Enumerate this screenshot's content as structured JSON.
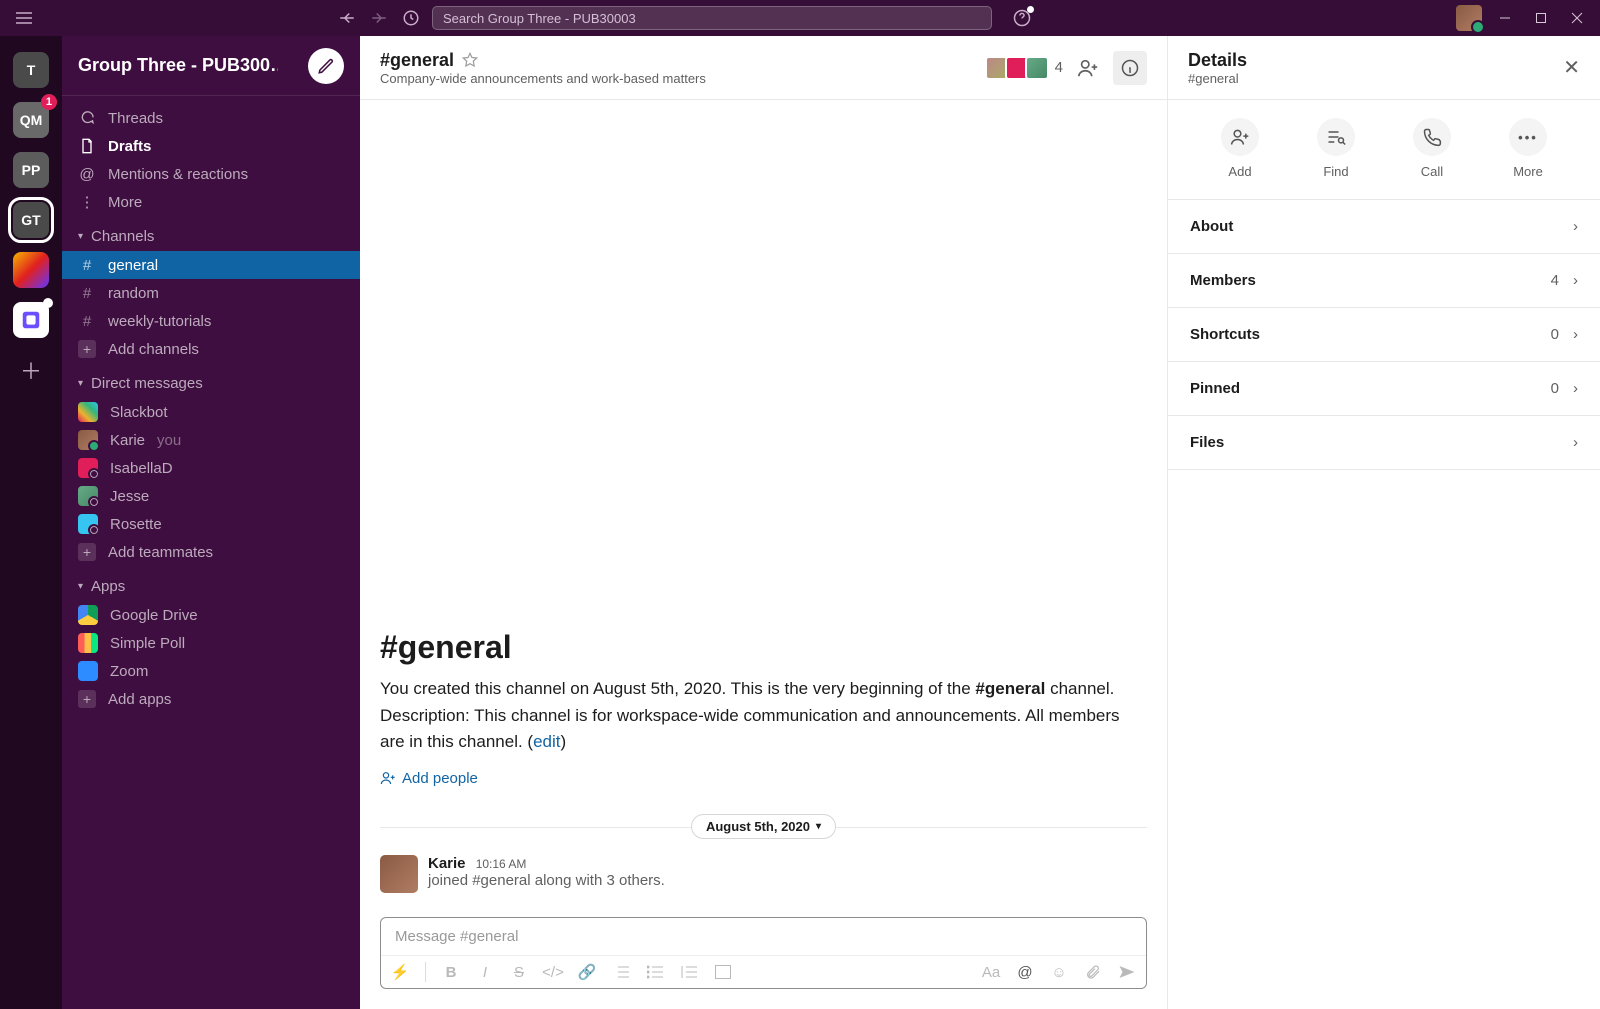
{
  "titlebar": {
    "search_placeholder": "Search Group Three - PUB30003"
  },
  "rail": {
    "workspaces": [
      {
        "label": "T",
        "bg": "#4a4a4a"
      },
      {
        "label": "QM",
        "bg": "#696969",
        "badge": "1"
      },
      {
        "label": "PP",
        "bg": "#5c5c5c"
      },
      {
        "label": "GT",
        "bg": "#4a4a4a",
        "selected": true
      }
    ]
  },
  "sidebar": {
    "workspace_name": "Group Three - PUB300…",
    "nav": {
      "threads": "Threads",
      "drafts": "Drafts",
      "mentions": "Mentions & reactions",
      "more": "More"
    },
    "channels_header": "Channels",
    "channels": [
      {
        "name": "general",
        "active": true
      },
      {
        "name": "random"
      },
      {
        "name": "weekly-tutorials"
      }
    ],
    "add_channels": "Add channels",
    "dms_header": "Direct messages",
    "dms": [
      {
        "name": "Slackbot",
        "type": "bot"
      },
      {
        "name": "Karie",
        "you_label": "you",
        "type": "self"
      },
      {
        "name": "IsabellaD",
        "type": "away"
      },
      {
        "name": "Jesse",
        "type": "away2"
      },
      {
        "name": "Rosette",
        "type": "away"
      }
    ],
    "add_teammates": "Add teammates",
    "apps_header": "Apps",
    "apps": [
      {
        "name": "Google Drive",
        "bg": "#fff"
      },
      {
        "name": "Simple Poll",
        "bg": "#fff"
      },
      {
        "name": "Zoom",
        "bg": "#2d8cff"
      }
    ],
    "add_apps": "Add apps"
  },
  "channel": {
    "name": "#general",
    "topic": "Company-wide announcements and work-based matters",
    "member_count": "4",
    "welcome_heading": "#general",
    "welcome_text_1": "You created this channel on August 5th, 2020. This is the very beginning of the ",
    "welcome_bold": "#general",
    "welcome_text_2": " channel. Description: This channel is for workspace-wide communication and announcements. All members are in this channel. (",
    "welcome_edit": "edit",
    "welcome_text_3": ")",
    "add_people": "Add people",
    "date_divider": "August 5th, 2020",
    "message": {
      "user": "Karie",
      "time": "10:16 AM",
      "text": "joined #general along with 3 others."
    },
    "composer_placeholder": "Message #general"
  },
  "details": {
    "title": "Details",
    "subtitle": "#general",
    "actions": {
      "add": "Add",
      "find": "Find",
      "call": "Call",
      "more": "More"
    },
    "rows": {
      "about": "About",
      "members": "Members",
      "members_count": "4",
      "shortcuts": "Shortcuts",
      "shortcuts_count": "0",
      "pinned": "Pinned",
      "pinned_count": "0",
      "files": "Files"
    }
  }
}
